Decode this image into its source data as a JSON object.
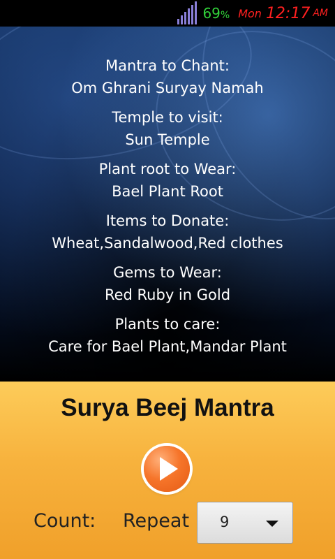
{
  "status_bar": {
    "battery_number": "69",
    "battery_unit": "%",
    "day": "Mon",
    "time": "12:17",
    "ampm": "AM",
    "colors": {
      "battery": "#32d23a",
      "clock": "#ff2020"
    }
  },
  "info": {
    "items": [
      {
        "label": "Mantra to Chant:",
        "value": "Om Ghrani Suryay Namah"
      },
      {
        "label": "Temple to visit:",
        "value": "Sun Temple"
      },
      {
        "label": "Plant root to Wear:",
        "value": "Bael Plant Root"
      },
      {
        "label": "Items to Donate:",
        "value": "Wheat,Sandalwood,Red clothes"
      },
      {
        "label": "Gems to Wear:",
        "value": "Red Ruby in Gold"
      },
      {
        "label": "Plants to care:",
        "value": "Care for Bael Plant,Mandar Plant"
      }
    ]
  },
  "player": {
    "title": "Surya Beej Mantra",
    "play_icon": "play-icon",
    "count_label": "Count:",
    "repeat_label": "Repeat",
    "repeat_value": "9",
    "dropdown_icon": "chevron-down-icon",
    "colors": {
      "panel": "#f7b23d",
      "play_button": "#f6752a"
    }
  }
}
